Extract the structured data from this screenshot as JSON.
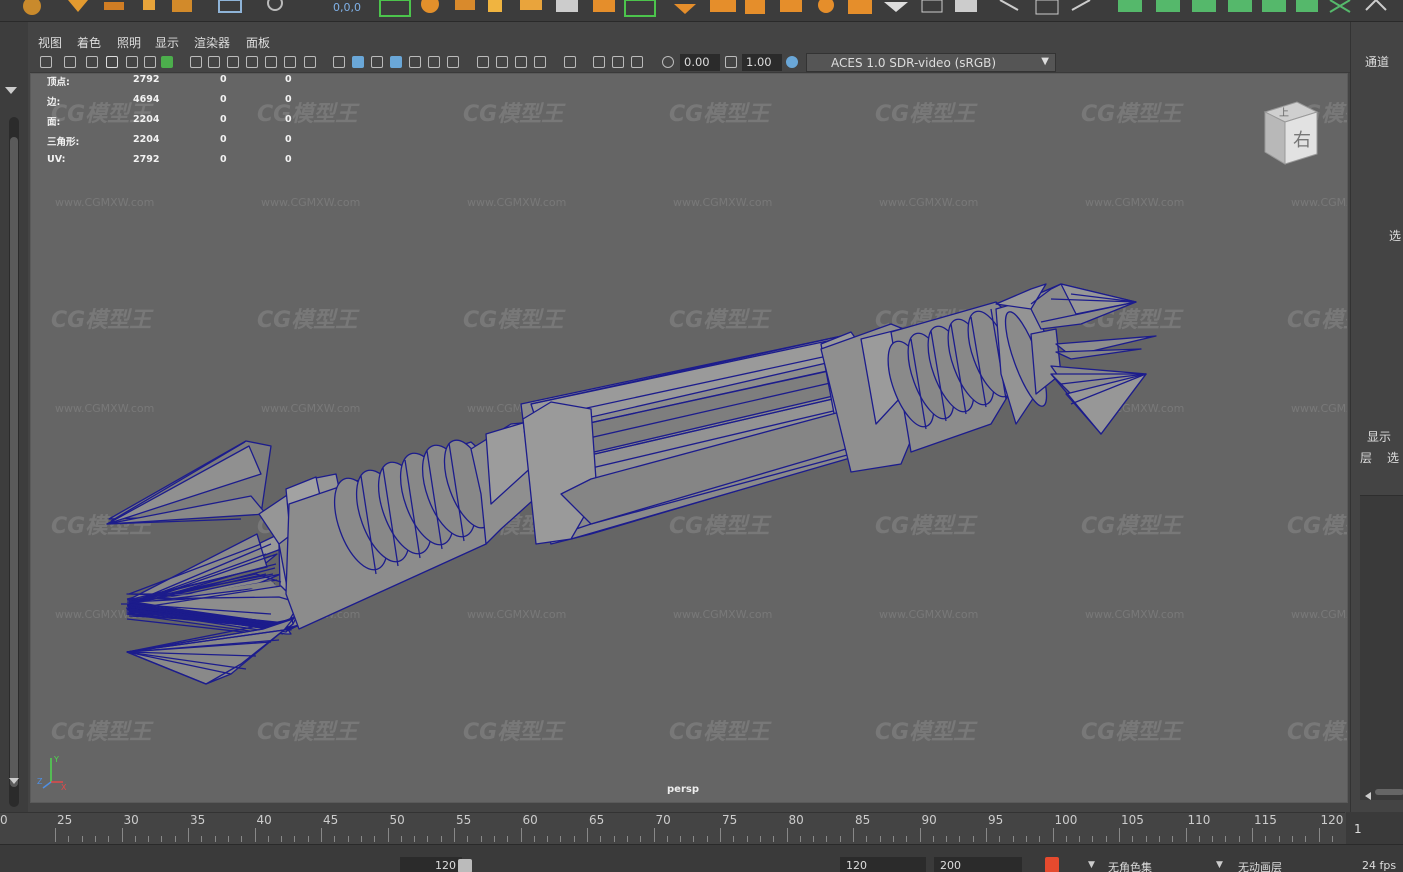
{
  "shelf": {
    "coords_readout": "0,0,0"
  },
  "panel_menu": [
    "视图",
    "着色",
    "照明",
    "显示",
    "渲染器",
    "面板"
  ],
  "toolbar": {
    "exposure": "0.00",
    "gamma": "1.00",
    "color_space": "ACES 1.0 SDR-video (sRGB)"
  },
  "hud": [
    {
      "label": "顶点:",
      "v1": "2792",
      "v2": "0",
      "v3": "0"
    },
    {
      "label": "边:",
      "v1": "4694",
      "v2": "0",
      "v3": "0"
    },
    {
      "label": "面:",
      "v1": "2204",
      "v2": "0",
      "v3": "0"
    },
    {
      "label": "三角形:",
      "v1": "2204",
      "v2": "0",
      "v3": "0"
    },
    {
      "label": "UV:",
      "v1": "2792",
      "v2": "0",
      "v3": "0"
    }
  ],
  "camera_name": "persp",
  "view_cube_label": "右",
  "view_cube_top": "上",
  "watermark": {
    "logo": "CG模型王",
    "url": "www.CGMXW.com"
  },
  "right_panel": {
    "channels": "通道",
    "select": "选",
    "display": "显示",
    "layer": "层",
    "option": "选"
  },
  "timeline": {
    "ticks": [
      "0",
      "25",
      "30",
      "35",
      "40",
      "45",
      "50",
      "55",
      "60",
      "65",
      "70",
      "75",
      "80",
      "85",
      "90",
      "95",
      "100",
      "105",
      "110",
      "115",
      "120"
    ],
    "current_frame": "1"
  },
  "range_bar": {
    "range_end": "120",
    "end_frame": "120",
    "max_frame": "200",
    "character_set": "无角色集",
    "anim_layer": "无动画层",
    "fps": "24 fps"
  },
  "colors": {
    "viewport_bg": "#656565",
    "wire": "#1c1c8c",
    "mesh": "#8a8a8a"
  }
}
